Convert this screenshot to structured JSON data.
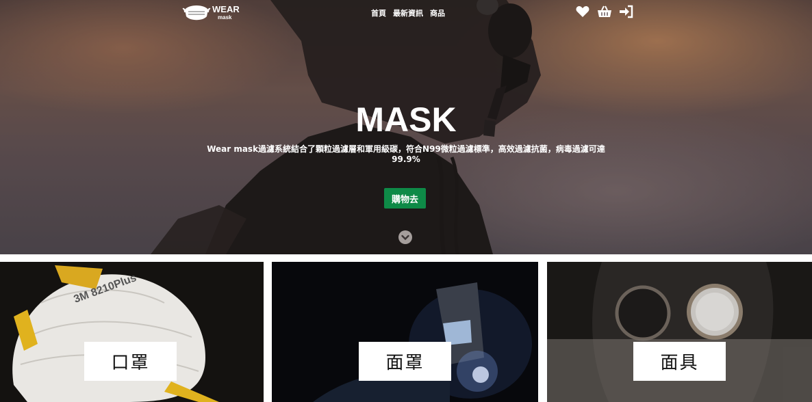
{
  "brand": {
    "title": "WEAR",
    "subtitle": "mask",
    "logo_icon": "mask-logo-icon"
  },
  "nav": {
    "items": [
      {
        "label": "首頁"
      },
      {
        "label": "最新資訊"
      },
      {
        "label": "商品"
      }
    ],
    "icons": [
      "heart-icon",
      "basket-icon",
      "sign-in-icon"
    ]
  },
  "hero": {
    "title": "MASK",
    "description": "Wear mask過濾系統結合了顆粒過濾層和軍用級碳，符合N99微粒過濾標準，高效過濾抗菌，病毒過濾可達99.9%",
    "cta_label": "購物去",
    "cta_color": "#0e8a47",
    "scroll_icon": "chevron-down-circle-icon"
  },
  "categories": [
    {
      "label": "口罩"
    },
    {
      "label": "面罩"
    },
    {
      "label": "面具"
    }
  ]
}
